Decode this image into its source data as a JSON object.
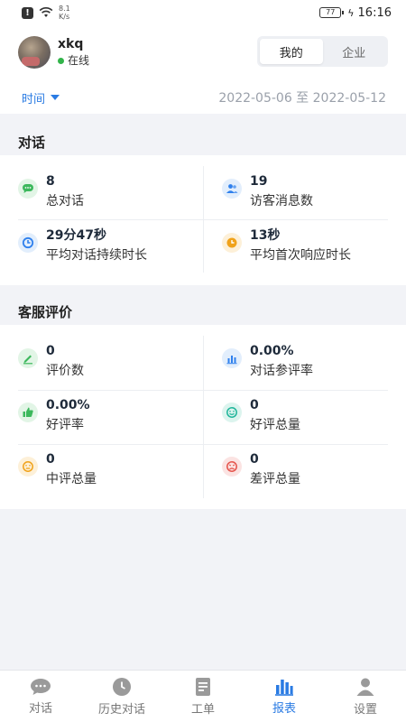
{
  "status_bar": {
    "speed_value": "8.1",
    "speed_unit": "K/s",
    "battery": "77",
    "time": "16:16"
  },
  "user": {
    "name": "xkq",
    "status": "在线"
  },
  "segment": {
    "items": [
      "我的",
      "企业"
    ],
    "active": 0
  },
  "filter": {
    "label": "时间",
    "date_range": "2022-05-06 至 2022-05-12"
  },
  "conversation": {
    "title": "对话",
    "stats": [
      {
        "value": "8",
        "label": "总对话",
        "icon": "chat-icon",
        "color": "#3cb85c"
      },
      {
        "value": "19",
        "label": "访客消息数",
        "icon": "visitors-icon",
        "color": "#2f80ed"
      },
      {
        "value": "29分47秒",
        "label": "平均对话持续时长",
        "icon": "timer-icon",
        "color": "#2f80ed"
      },
      {
        "value": "13秒",
        "label": "平均首次响应时长",
        "icon": "clock-icon",
        "color": "#f0a21a"
      }
    ]
  },
  "rating": {
    "title": "客服评价",
    "stats": [
      {
        "value": "0",
        "label": "评价数",
        "icon": "edit-icon",
        "color": "#3cb85c"
      },
      {
        "value": "0.00%",
        "label": "对话参评率",
        "icon": "bar-chart-icon",
        "color": "#2f80ed"
      },
      {
        "value": "0.00%",
        "label": "好评率",
        "icon": "thumb-up-icon",
        "color": "#3cb85c"
      },
      {
        "value": "0",
        "label": "好评总量",
        "icon": "smile-icon",
        "color": "#1fb59a"
      },
      {
        "value": "0",
        "label": "中评总量",
        "icon": "neutral-face-icon",
        "color": "#f0a21a"
      },
      {
        "value": "0",
        "label": "差评总量",
        "icon": "sad-face-icon",
        "color": "#e5534b"
      }
    ]
  },
  "nav": {
    "items": [
      {
        "label": "对话",
        "icon": "chat-bubble-icon"
      },
      {
        "label": "历史对话",
        "icon": "history-icon"
      },
      {
        "label": "工单",
        "icon": "ticket-icon"
      },
      {
        "label": "报表",
        "icon": "report-icon"
      },
      {
        "label": "设置",
        "icon": "settings-user-icon"
      }
    ],
    "active": 3
  },
  "colors": {
    "accent": "#2a7be3",
    "online": "#32b44a",
    "background": "#f2f3f7"
  }
}
